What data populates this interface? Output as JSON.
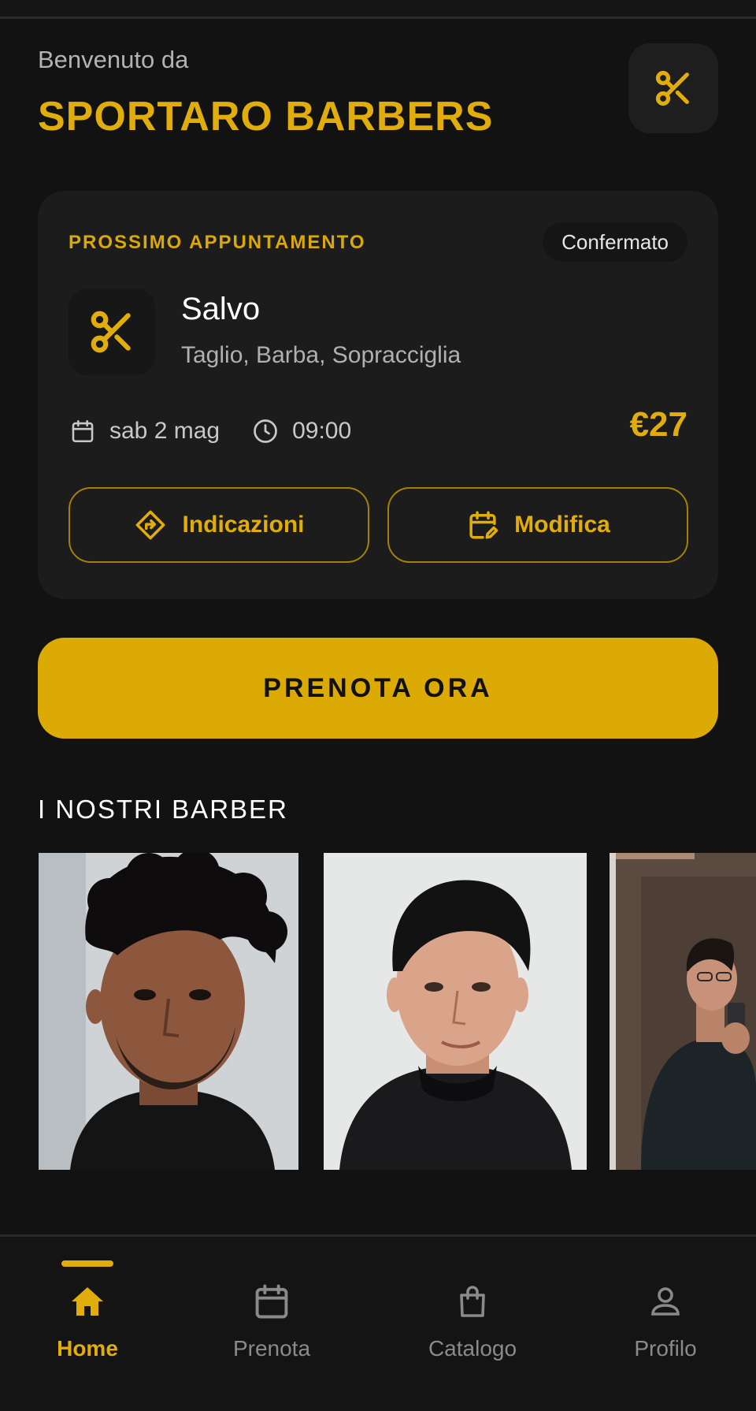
{
  "header": {
    "welcome": "Benvenuto da",
    "brand": "SPORTARO BARBERS",
    "logo_icon": "scissors-icon"
  },
  "appointment": {
    "label": "PROSSIMO APPUNTAMENTO",
    "status": "Confermato",
    "service_icon": "scissors-icon",
    "barber": "Salvo",
    "services": "Taglio, Barba, Sopracciglia",
    "date": "sab 2 mag",
    "time": "09:00",
    "price": "€27",
    "directions_label": "Indicazioni",
    "edit_label": "Modifica"
  },
  "cta": {
    "label": "PRENOTA ORA"
  },
  "barbers": {
    "title": "I NOSTRI BARBER"
  },
  "nav": {
    "items": [
      {
        "label": "Home",
        "icon": "home-icon",
        "active": true
      },
      {
        "label": "Prenota",
        "icon": "calendar-icon",
        "active": false
      },
      {
        "label": "Catalogo",
        "icon": "shopping-bag-icon",
        "active": false
      },
      {
        "label": "Profilo",
        "icon": "person-icon",
        "active": false
      }
    ]
  },
  "colors": {
    "accent": "#dcaa05",
    "background": "#121212",
    "card": "#1c1c1c",
    "muted_text": "#8a8a8a"
  }
}
